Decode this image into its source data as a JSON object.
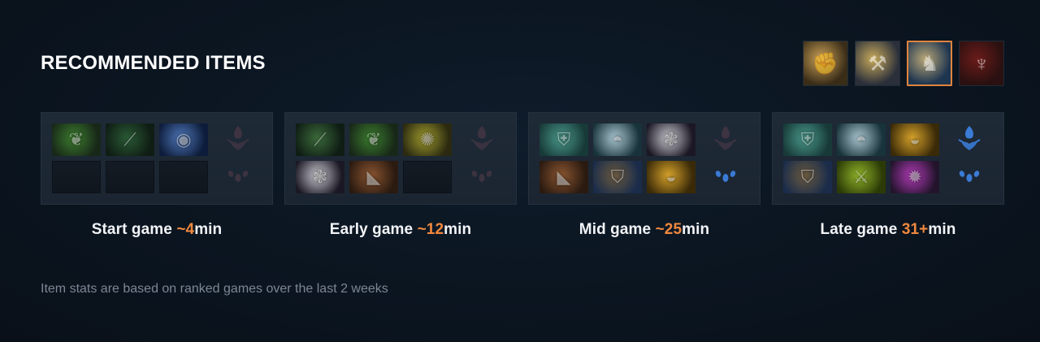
{
  "section": {
    "title": "RECOMMENDED ITEMS",
    "footnote": "Item stats are based on ranked games over the last 2 weeks"
  },
  "hero_tabs": [
    {
      "icon": "fist-icon",
      "colors": [
        "#3a2d18",
        "#c9a057"
      ],
      "selected": false
    },
    {
      "icon": "axe-icon",
      "colors": [
        "#2a2f3a",
        "#c8aa5c"
      ],
      "selected": false
    },
    {
      "icon": "hero-portrait-icon",
      "colors": [
        "#1e3550",
        "#b9a777"
      ],
      "selected": true
    },
    {
      "icon": "red-demon-icon",
      "colors": [
        "#2a1010",
        "#6a1c1a"
      ],
      "selected": false
    }
  ],
  "phases": [
    {
      "label": "Start game ",
      "time": "~4",
      "unit": "min",
      "neutral_colors": [
        "#3d3341",
        "#3d3341"
      ],
      "items": [
        {
          "icon": "green-mask-icon",
          "colors": [
            "#182818",
            "#3c7d2f"
          ]
        },
        {
          "icon": "green-wand-icon",
          "colors": [
            "#0f1d14",
            "#2a5a35"
          ]
        },
        {
          "icon": "blue-orb-icon",
          "colors": [
            "#0d1c3a",
            "#4f77b9"
          ]
        },
        {
          "icon": "empty-slot",
          "colors": []
        },
        {
          "icon": "empty-slot",
          "colors": []
        },
        {
          "icon": "empty-slot",
          "colors": []
        }
      ]
    },
    {
      "label": "Early game ",
      "time": "~12",
      "unit": "min",
      "neutral_colors": [
        "#3d3341",
        "#3d3341"
      ],
      "items": [
        {
          "icon": "green-staff-icon",
          "colors": [
            "#0f1d14",
            "#3b6a3a"
          ]
        },
        {
          "icon": "green-mask-icon",
          "colors": [
            "#182818",
            "#3c7d2f"
          ]
        },
        {
          "icon": "yellow-rune-icon",
          "colors": [
            "#2b2a10",
            "#9e9a2e"
          ]
        },
        {
          "icon": "feather-crown-icon",
          "colors": [
            "#1b1724",
            "#c9c9cf"
          ]
        },
        {
          "icon": "boots-icon",
          "colors": [
            "#2a1a10",
            "#8a5530"
          ]
        },
        {
          "icon": "empty-slot",
          "colors": []
        }
      ]
    },
    {
      "label": "Mid game ",
      "time": "~25",
      "unit": "min",
      "neutral_colors": [
        "#3d3341",
        "#3a7bd5"
      ],
      "items": [
        {
          "icon": "teal-armor-icon",
          "colors": [
            "#173a38",
            "#4b9a8c"
          ]
        },
        {
          "icon": "silver-helm-icon",
          "colors": [
            "#18333b",
            "#a9c5cf"
          ]
        },
        {
          "icon": "feather-crown-icon",
          "colors": [
            "#1b1724",
            "#c9c9cf"
          ]
        },
        {
          "icon": "boots-icon",
          "colors": [
            "#2a1a10",
            "#8a5530"
          ]
        },
        {
          "icon": "blue-armor-icon",
          "colors": [
            "#1a2c4a",
            "#6b5a3f"
          ]
        },
        {
          "icon": "gold-helm-icon",
          "colors": [
            "#3a2a08",
            "#d6a22a"
          ]
        }
      ]
    },
    {
      "label": "Late game ",
      "time": "31+",
      "unit": "min",
      "neutral_colors": [
        "#3a7bd5",
        "#3a7bd5"
      ],
      "items": [
        {
          "icon": "teal-armor-icon",
          "colors": [
            "#173a38",
            "#4b9a8c"
          ]
        },
        {
          "icon": "silver-helm-icon",
          "colors": [
            "#18333b",
            "#a9c5cf"
          ]
        },
        {
          "icon": "gold-helm-icon",
          "colors": [
            "#3a2a08",
            "#d6a22a"
          ]
        },
        {
          "icon": "blue-armor-icon",
          "colors": [
            "#1a2c4a",
            "#6b5a3f"
          ]
        },
        {
          "icon": "green-blade-icon",
          "colors": [
            "#2c3a06",
            "#8fb42a"
          ]
        },
        {
          "icon": "purple-orb-icon",
          "colors": [
            "#23142c",
            "#b13bb7"
          ]
        }
      ]
    }
  ],
  "accent_color": "#f0883e"
}
